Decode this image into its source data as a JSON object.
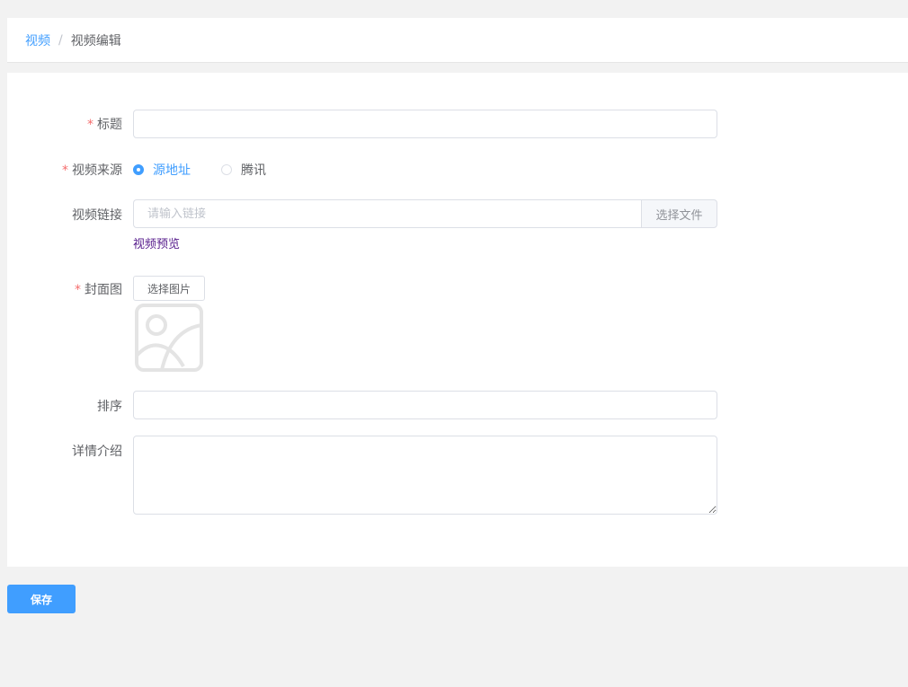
{
  "breadcrumb": {
    "items": [
      {
        "label": "视频"
      },
      {
        "label": "视频编辑"
      }
    ],
    "separator": "/"
  },
  "form": {
    "title": {
      "required_mark": "*",
      "label": "标题",
      "value": "",
      "placeholder": ""
    },
    "source": {
      "required_mark": "*",
      "label": "视频来源",
      "options": [
        {
          "label": "源地址",
          "checked": true
        },
        {
          "label": "腾讯",
          "checked": false
        }
      ]
    },
    "video_link": {
      "label": "视频链接",
      "value": "",
      "placeholder": "请输入链接",
      "append_button": "选择文件",
      "preview_link": "视频预览"
    },
    "cover": {
      "required_mark": "*",
      "label": "封面图",
      "button": "选择图片",
      "placeholder_icon": "image-placeholder-icon"
    },
    "sort": {
      "label": "排序",
      "value": "",
      "placeholder": ""
    },
    "description": {
      "label": "详情介绍",
      "value": "",
      "placeholder": ""
    }
  },
  "actions": {
    "save_label": "保存"
  },
  "colors": {
    "primary": "#409eff",
    "required": "#f56c6c",
    "border": "#dcdfe6",
    "page_bg": "#f2f2f2",
    "visited_link": "#551a8b"
  }
}
